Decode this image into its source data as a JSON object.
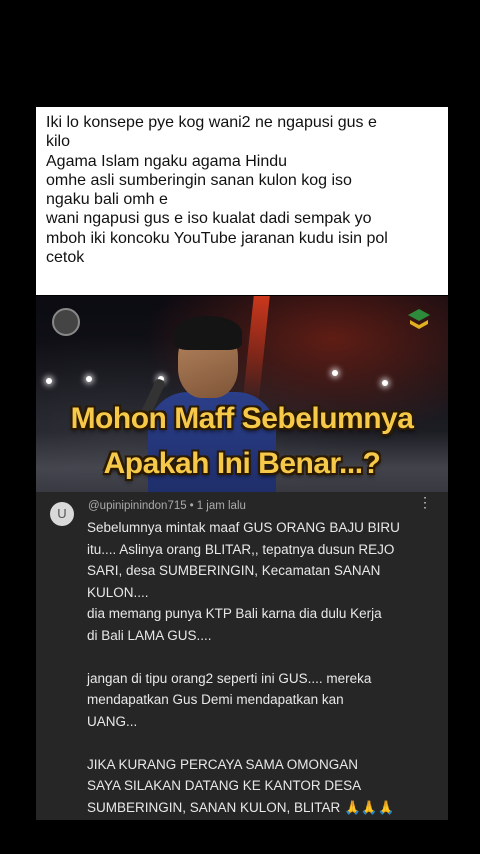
{
  "text_card": {
    "lines": [
      "Iki lo konsepe pye kog wani2 ne ngapusi gus e",
      "kilo",
      "Agama Islam ngaku agama Hindu",
      "omhe asli sumberingin sanan kulon kog iso",
      "ngaku bali omh e",
      "wani ngapusi gus e iso kualat dadi sempak yo",
      "mboh iki koncoku YouTube jaranan kudu isin pol",
      "cetok"
    ]
  },
  "video": {
    "caption_line1": "Mohon Maff Sebelumnya",
    "caption_line2": "Apakah Ini Benar...?",
    "caption_color": "#f6c94a"
  },
  "comment": {
    "avatar_letter": "U",
    "username": "@upinipinindon715",
    "separator": "•",
    "time": "1 jam lalu",
    "more_icon": "⋮",
    "lines": [
      "Sebelumnya mintak maaf GUS ORANG BAJU BIRU",
      "itu.... Aslinya orang BLITAR,, tepatnya dusun REJO",
      "SARI, desa SUMBERINGIN, Kecamatan SANAN",
      "KULON....",
      "dia memang punya KTP Bali karna dia dulu Kerja",
      "di Bali LAMA GUS....",
      "",
      "jangan di tipu orang2 seperti ini GUS.... mereka",
      "mendapatkan Gus Demi mendapatkan kan",
      "UANG...",
      "",
      "JIKA KURANG PERCAYA SAMA OMONGAN",
      "SAYA SILAKAN DATANG KE KANTOR DESA",
      "SUMBERINGIN, SANAN KULON, BLITAR"
    ],
    "pray_emoji": "🙏🙏🙏"
  }
}
